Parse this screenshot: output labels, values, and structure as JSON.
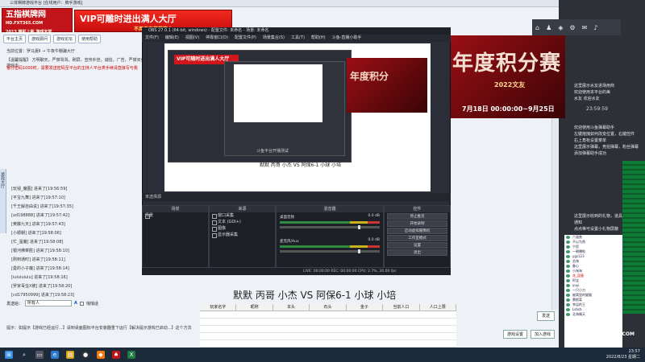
{
  "client": {
    "title": "三体棋牌游戏平台 [在线用户：牌手游戏]",
    "logo_main": "五指棋牌网",
    "logo_url": "HD.FXT365.COM",
    "logo_slogan": "2013 精彩上新 游戏天堂",
    "vip_banner": "VIP可雕时进出满人大厅",
    "vip_sub": "不用辛辛苦苦等人",
    "nav": [
      "平台主页",
      "游戏顾问",
      "游戏论坛",
      "使用帮助"
    ],
    "room_info": "当前位置：罗马夏Ⅱ → 午夜牛棚骗大厅",
    "notice1": "【温馨提醒】 方明聊天，严禁骂骂，刷屏，宣传外挂，诚信，广告，严禁买卖游戏币",
    "notice2": "银行密码1000时，需要发送密码至平台的主持人平台类手续请直接写与我",
    "sidebar_label": "游戏大厅",
    "chat_log": [
      "[玩钱_魔图] 进来了[19:56:59]",
      "[平宝九舞] 进来了[19:57:10]",
      "[千王解自由说] 进来了[19:57:35]",
      "[xd198888] 进来了[19:57:42]",
      "[黄藤九天] 进来了[19:57:43]",
      "[小顺朝] 进来了[19:58:06]",
      "[忙_温魔] 进来了[19:58:08]",
      "[银河佛菜胜] 进来了[19:58:10]",
      "[刚到通时] 进来了[19:58:11]",
      "[曼的小子魔] 进来了[19:58:14]",
      "[iuiuiuiuiu] 进来了[19:58:16]",
      "[罗家毒虫X被] 进来了[19:58:20]",
      "[cd17950999] 进来了[19:58:23]"
    ],
    "send_to_label": "发送给：",
    "send_to_value": "所有人",
    "private_label": "悄悄话",
    "tip": "提示：如提示【游戏已经运行...】请到桌面图标平台安装器重下运行【解决提示游戏已启动...】这个方法",
    "send_button": "发送",
    "game_settings_button": "游戏设置",
    "join_game_button": "加入游戏"
  },
  "right_panel": {
    "banner_text": "年度积分赛",
    "banner_year": "2022文友",
    "banner_date": "7月18日 00:00:00~9月25日",
    "time": "23:59:59",
    "text1": [
      "这里展示水友进场用商",
      "欢迎使用本平台的美",
      "水友 欢迎水友"
    ],
    "text2": [
      "欢迎使用斗鱼弹幕助手",
      "左键拖拽如何改变位置，右键控件",
      "右上角有设置菜单",
      "这里展示弹幕，竞拍弹幕，粉丝弹幕",
      "添加弹幕助手成功"
    ],
    "text3": [
      "这里展示收到的礼物，道具，贵族",
      "通知",
      "点点等可设置小礼物屏蔽"
    ],
    "users": [
      "六道叁",
      "不以为然",
      "宁愿",
      "一朝爆啦",
      "ygs123",
      "沧海",
      "鲁心",
      "小淘淘",
      "花_昆唐",
      "阿宝",
      "yuyi",
      "一只小刀",
      "被窝里的猫猫",
      "慕斯菜",
      "幸运的王",
      "Lsbcb",
      "北海晴天"
    ],
    "brand": "DOUYU.COM"
  },
  "obs": {
    "title": "OBS 27.0.1 (64-bit, windows) - 配置文件: 未命名 - 场景: 未命名",
    "menu": [
      "文件(F)",
      "编辑(E)",
      "视图(V)",
      "停靠窗口(D)",
      "配置文件(P)",
      "场景集合(S)",
      "工具(T)",
      "帮助(H)",
      "斗鱼-直播小助手"
    ],
    "nested_red": "VIP可随时进出满人大厅",
    "nested_banner": "年度积分",
    "nested_caption": "斗鱼平台开播测试",
    "preview_caption": "默默 丙哥 小杰 VS 阿保6-1 小球 小培",
    "no_source": "未选择源",
    "docks": {
      "scenes": "场景",
      "sources": "来源",
      "mixer": "混音器",
      "controls": "控件"
    },
    "scene_items": [
      "场景"
    ],
    "source_items": [
      "窗口采集",
      "文本 (GDI+)",
      "图像",
      "显示器采集"
    ],
    "mixer": [
      {
        "name": "桌面音频",
        "value": "0.0 dB"
      },
      {
        "name": "麦克风/Aux",
        "value": "0.0 dB"
      }
    ],
    "controls": [
      "停止推流",
      "开始录制",
      "启动虚拟摄像机",
      "工作室模式",
      "设置",
      "退出"
    ],
    "status": "LIVE: 00:00:00   REC: 00:00:00   CPU: 2.7%, 30.00 fps"
  },
  "caption": "默默 丙哥 小杰 VS 阿保6-1 小球 小培",
  "sheet": {
    "columns": [
      "玩家名字",
      "昵称",
      "本头",
      "石头",
      "金子",
      "当前人口",
      "人口上限"
    ]
  },
  "taskbar": {
    "clock_time": "23:57",
    "clock_date": "2022/8/23 星期二"
  }
}
